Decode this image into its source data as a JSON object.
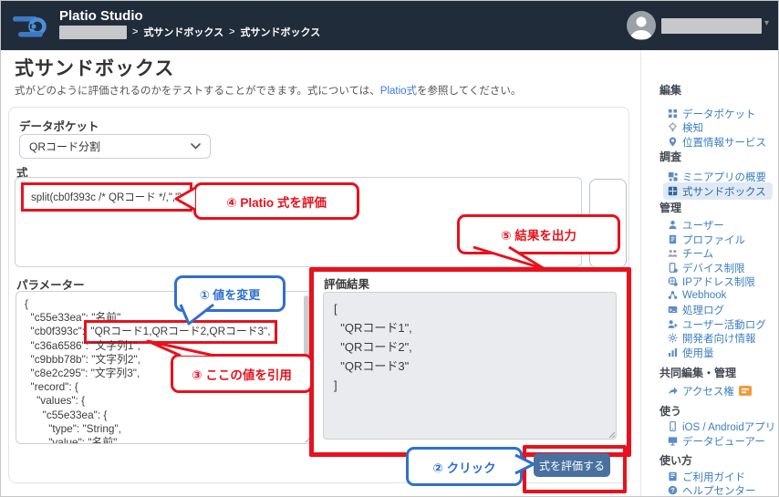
{
  "header": {
    "app_title": "Platio Studio",
    "breadcrumb_sep1": ">",
    "breadcrumb_item1": "式サンドボックス",
    "breadcrumb_sep2": ">",
    "breadcrumb_item2": "式サンドボックス",
    "user_caret": "▾"
  },
  "page": {
    "title": "式サンドボックス",
    "desc_before": "式がどのように評価されるのかをテストすることができます。式については、",
    "desc_link": "Platio式",
    "desc_after": "を参照してください。"
  },
  "form": {
    "data_pocket_label": "データポケット",
    "data_pocket_value": "QRコード分割",
    "expression_label": "式",
    "expression_value": "split(cb0f393c /* QRコード */,\",\")",
    "parameters_label": "パラメーター",
    "result_label": "評価結果",
    "evaluate_button_label": "式を評価する"
  },
  "parameters_json": {
    "l0": "{",
    "l1": "  \"c55e33ea\": \"名前\",",
    "l2_key": "  \"cb0f393c\": ",
    "l2_value": "\"QRコード1,QRコード2,QRコード3\",",
    "l3": "  \"c36a6586\": \"文字列1\",",
    "l4": "  \"c9bbb78b\": \"文字列2\",",
    "l5": "  \"c8e2c295\": \"文字列3\",",
    "l6": "  \"record\": {",
    "l7": "    \"values\": {",
    "l8": "      \"c55e33ea\": {",
    "l9": "        \"type\": \"String\",",
    "l10": "        \"value\": \"名前\","
  },
  "result_json": {
    "l0": "[",
    "l1": "  \"QRコード1\",",
    "l2": "  \"QRコード2\",",
    "l3": "  \"QRコード3\"",
    "l4": "]"
  },
  "annotations": {
    "step1": "① 値を変更",
    "step2": "② クリック",
    "step3": "③ ここの値を引用",
    "step4": "④ Platio 式を評価",
    "step5": "⑤ 結果を出力"
  },
  "sidebar": {
    "sections": [
      {
        "label": "編集",
        "items": [
          {
            "label": "データポケット",
            "icon": "pocket-grid-icon"
          },
          {
            "label": "検知",
            "icon": "detection-icon"
          },
          {
            "label": "位置情報サービス",
            "icon": "location-icon"
          }
        ]
      },
      {
        "label": "調査",
        "items": [
          {
            "label": "ミニアプリの概要",
            "icon": "miniapp-overview-icon"
          },
          {
            "label": "式サンドボックス",
            "icon": "expression-sandbox-icon"
          }
        ]
      },
      {
        "label": "管理",
        "items": [
          {
            "label": "ユーザー",
            "icon": "users-icon"
          },
          {
            "label": "プロファイル",
            "icon": "profile-icon"
          },
          {
            "label": "チーム",
            "icon": "team-icon"
          },
          {
            "label": "デバイス制限",
            "icon": "device-restriction-icon"
          },
          {
            "label": "IPアドレス制限",
            "icon": "ip-restriction-icon"
          },
          {
            "label": "Webhook",
            "icon": "webhook-icon"
          },
          {
            "label": "処理ログ",
            "icon": "process-log-icon"
          },
          {
            "label": "ユーザー活動ログ",
            "icon": "user-activity-log-icon"
          },
          {
            "label": "開発者向け情報",
            "icon": "developer-info-icon"
          },
          {
            "label": "使用量",
            "icon": "usage-icon"
          }
        ]
      },
      {
        "label": "共同編集・管理",
        "items": [
          {
            "label": "アクセス権",
            "icon": "access-rights-icon"
          }
        ]
      },
      {
        "label": "使う",
        "items": [
          {
            "label": "iOS / Androidアプリ",
            "icon": "mobile-apps-icon"
          },
          {
            "label": "データビューアー",
            "icon": "data-viewer-icon"
          }
        ]
      },
      {
        "label": "使い方",
        "items": [
          {
            "label": "ご利用ガイド",
            "icon": "guide-icon"
          },
          {
            "label": "ヘルプセンター",
            "icon": "help-icon"
          }
        ]
      }
    ]
  },
  "colors": {
    "header_bg": "#212c3b",
    "annotation_red": "#e8111c",
    "annotation_blue": "#2f6fd1",
    "link_blue": "#3a7bd5",
    "button_blue": "#48719f",
    "sidebar_link": "#3c7fc0"
  }
}
